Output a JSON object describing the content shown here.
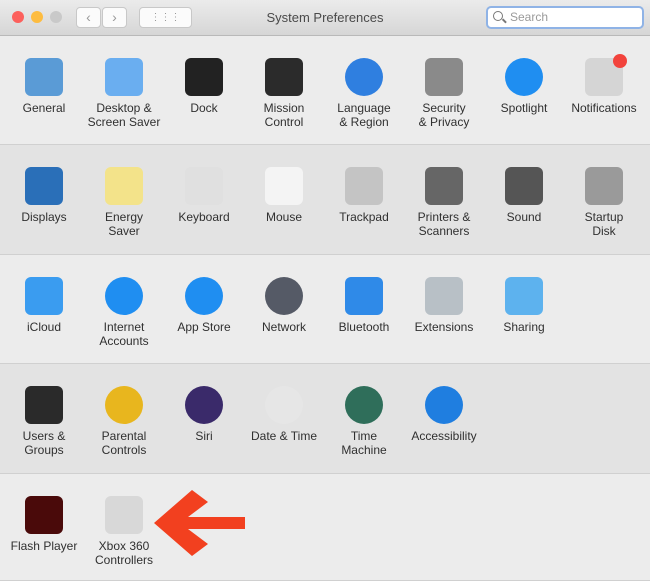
{
  "window": {
    "title": "System Preferences",
    "back": "‹",
    "forward": "›",
    "grid": "⋮⋮⋮"
  },
  "search": {
    "placeholder": "Search"
  },
  "sections": [
    [
      {
        "label": "General",
        "icon": "general-icon",
        "color": "#5a9bd6"
      },
      {
        "label": "Desktop & Screen Saver",
        "icon": "desktop-icon",
        "color": "#6aaef0"
      },
      {
        "label": "Dock",
        "icon": "dock-icon",
        "color": "#222222"
      },
      {
        "label": "Mission Control",
        "icon": "mission-control-icon",
        "color": "#2b2b2b"
      },
      {
        "label": "Language & Region",
        "icon": "flag-globe-icon",
        "color": "#2f7fe0"
      },
      {
        "label": "Security & Privacy",
        "icon": "house-lock-icon",
        "color": "#8a8a8a"
      },
      {
        "label": "Spotlight",
        "icon": "magnifier-icon",
        "color": "#1f8ef1"
      },
      {
        "label": "Notifications",
        "icon": "notifications-icon",
        "color": "#d5d5d5"
      }
    ],
    [
      {
        "label": "Displays",
        "icon": "display-icon",
        "color": "#2a6fb8"
      },
      {
        "label": "Energy Saver",
        "icon": "lightbulb-icon",
        "color": "#f3e38a"
      },
      {
        "label": "Keyboard",
        "icon": "keyboard-icon",
        "color": "#e0e0e0"
      },
      {
        "label": "Mouse",
        "icon": "mouse-icon",
        "color": "#f4f4f4"
      },
      {
        "label": "Trackpad",
        "icon": "trackpad-icon",
        "color": "#c4c4c4"
      },
      {
        "label": "Printers & Scanners",
        "icon": "printer-icon",
        "color": "#666666"
      },
      {
        "label": "Sound",
        "icon": "speaker-icon",
        "color": "#555555"
      },
      {
        "label": "Startup Disk",
        "icon": "disk-icon",
        "color": "#9a9a9a"
      }
    ],
    [
      {
        "label": "iCloud",
        "icon": "cloud-icon",
        "color": "#3a9cf0"
      },
      {
        "label": "Internet Accounts",
        "icon": "at-sign-icon",
        "color": "#1f8ef1"
      },
      {
        "label": "App Store",
        "icon": "app-store-icon",
        "color": "#1f8ef1"
      },
      {
        "label": "Network",
        "icon": "globe-icon",
        "color": "#555a66"
      },
      {
        "label": "Bluetooth",
        "icon": "bluetooth-icon",
        "color": "#2f8ae8"
      },
      {
        "label": "Extensions",
        "icon": "puzzle-icon",
        "color": "#b8c0c6"
      },
      {
        "label": "Sharing",
        "icon": "sharing-folder-icon",
        "color": "#5db2ee"
      }
    ],
    [
      {
        "label": "Users & Groups",
        "icon": "users-icon",
        "color": "#2a2a2a"
      },
      {
        "label": "Parental Controls",
        "icon": "parental-icon",
        "color": "#e8b61e"
      },
      {
        "label": "Siri",
        "icon": "siri-icon",
        "color": "#3a2a6a"
      },
      {
        "label": "Date & Time",
        "icon": "clock-calendar-icon",
        "color": "#e6e6e6"
      },
      {
        "label": "Time Machine",
        "icon": "time-machine-icon",
        "color": "#2f6e5a"
      },
      {
        "label": "Accessibility",
        "icon": "accessibility-icon",
        "color": "#1f7ee0"
      }
    ],
    [
      {
        "label": "Flash Player",
        "icon": "flash-icon",
        "color": "#4a0a0a"
      },
      {
        "label": "Xbox 360 Controllers",
        "icon": "gamepad-icon",
        "color": "#d8d8d8"
      }
    ]
  ],
  "annotation": {
    "arrow_color": "#f2401f"
  }
}
